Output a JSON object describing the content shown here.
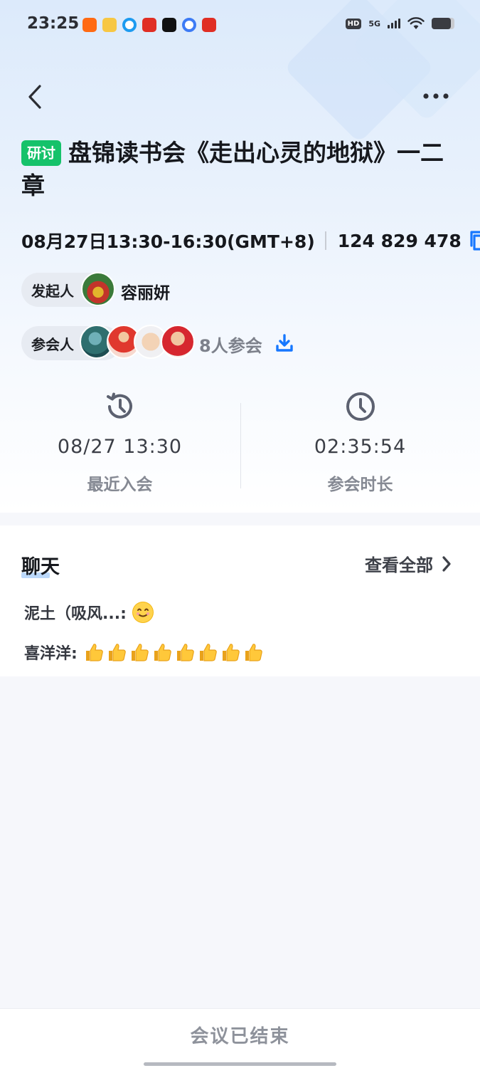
{
  "status_bar": {
    "time": "23:25",
    "notification_icons": [
      "taobao-icon",
      "weibo-icon",
      "browser-icon",
      "pinduoduo-icon",
      "tiktok-icon",
      "music-icon",
      "pinduoduo-icon"
    ],
    "hd_label": "HD",
    "network_label": "5G",
    "battery_level_pct": 85
  },
  "meeting": {
    "tag": "研讨",
    "title": "盘锦读书会《走出心灵的地狱》一二章",
    "datetime": "08月27日13:30-16:30(GMT+8)",
    "meeting_id": "124 829 478",
    "host_label": "发起人",
    "host_name": "容丽妍",
    "participants_label": "参会人",
    "participants_count_text": "8人参会"
  },
  "stats": {
    "last_join_value": "08/27 13:30",
    "last_join_label": "最近入会",
    "duration_value": "02:35:54",
    "duration_label": "参会时长"
  },
  "chat": {
    "title": "聊天",
    "view_all": "查看全部",
    "messages": [
      {
        "sender": "泥土（吸风...:",
        "content_emoji": "smiling-face",
        "count": 1
      },
      {
        "sender": "喜洋洋:",
        "content_emoji": "thumbs-up",
        "count": 8
      }
    ]
  },
  "footer": {
    "status_text": "会议已结束"
  },
  "colors": {
    "tag_green": "#15c26a",
    "accent_blue": "#1677ff",
    "muted_text": "#858993"
  }
}
